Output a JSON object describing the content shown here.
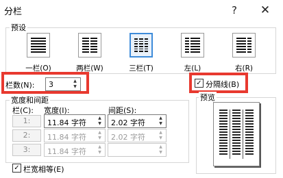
{
  "window": {
    "title": "分栏",
    "help_glyph": "?",
    "close_glyph": "✕"
  },
  "presets": {
    "label": "预设",
    "items": [
      {
        "label": "一栏(O)",
        "columns": 1,
        "selected": false
      },
      {
        "label": "两栏(W)",
        "columns": 2,
        "selected": false
      },
      {
        "label": "三栏(T)",
        "columns": 3,
        "selected": true
      },
      {
        "label": "左(L)",
        "columns": 2,
        "selected": false
      },
      {
        "label": "右(R)",
        "columns": 2,
        "selected": false
      }
    ]
  },
  "column_count": {
    "label": "栏数(N):",
    "value": "3"
  },
  "separator_line": {
    "label": "分隔线(B)",
    "checked": true
  },
  "width_spacing": {
    "label": "宽度和间距",
    "col_header": "栏(C):",
    "width_header": "宽度(I):",
    "spacing_header": "间距(S):",
    "rows": [
      {
        "col": "1:",
        "width": "11.84 字符",
        "spacing": "2.02 字符"
      },
      {
        "col": "2:",
        "width": "11.84 字符",
        "spacing": "2.02 字符"
      },
      {
        "col": "3:",
        "width": "11.84 字符",
        "spacing": ""
      }
    ]
  },
  "equal_width": {
    "label": "栏宽相等(E)",
    "checked": true
  },
  "preview": {
    "label": "预览"
  },
  "colors": {
    "highlight": "#e8392f",
    "selected_border": "#3d8bd9"
  }
}
